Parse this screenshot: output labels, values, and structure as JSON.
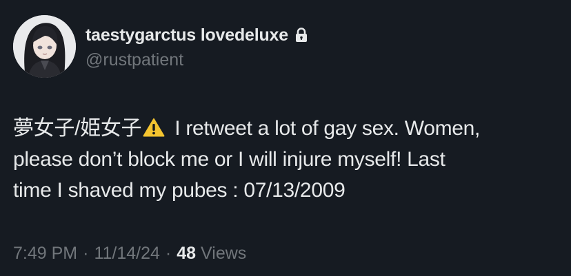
{
  "profile": {
    "display_name": "taestygarctus lovedeluxe",
    "handle": "@rustpatient",
    "locked_icon": "lock-icon"
  },
  "tweet": {
    "line1_prefix": "夢女子/姫女子",
    "warning_icon": "warning-emoji",
    "line1_suffix": " I retweet a lot of gay sex. Women,",
    "line2": "please don’t block me or I will injure myself! Last",
    "line3": "time I shaved my pubes : 07/13/2009"
  },
  "meta": {
    "time": "7:49 PM",
    "separator": "·",
    "date": "11/14/24",
    "views_count": "48",
    "views_label": "Views"
  },
  "colors": {
    "background": "#161b22",
    "primary_text": "#e7e9ea",
    "secondary_text": "#71767b",
    "warning_yellow": "#f4c430"
  }
}
